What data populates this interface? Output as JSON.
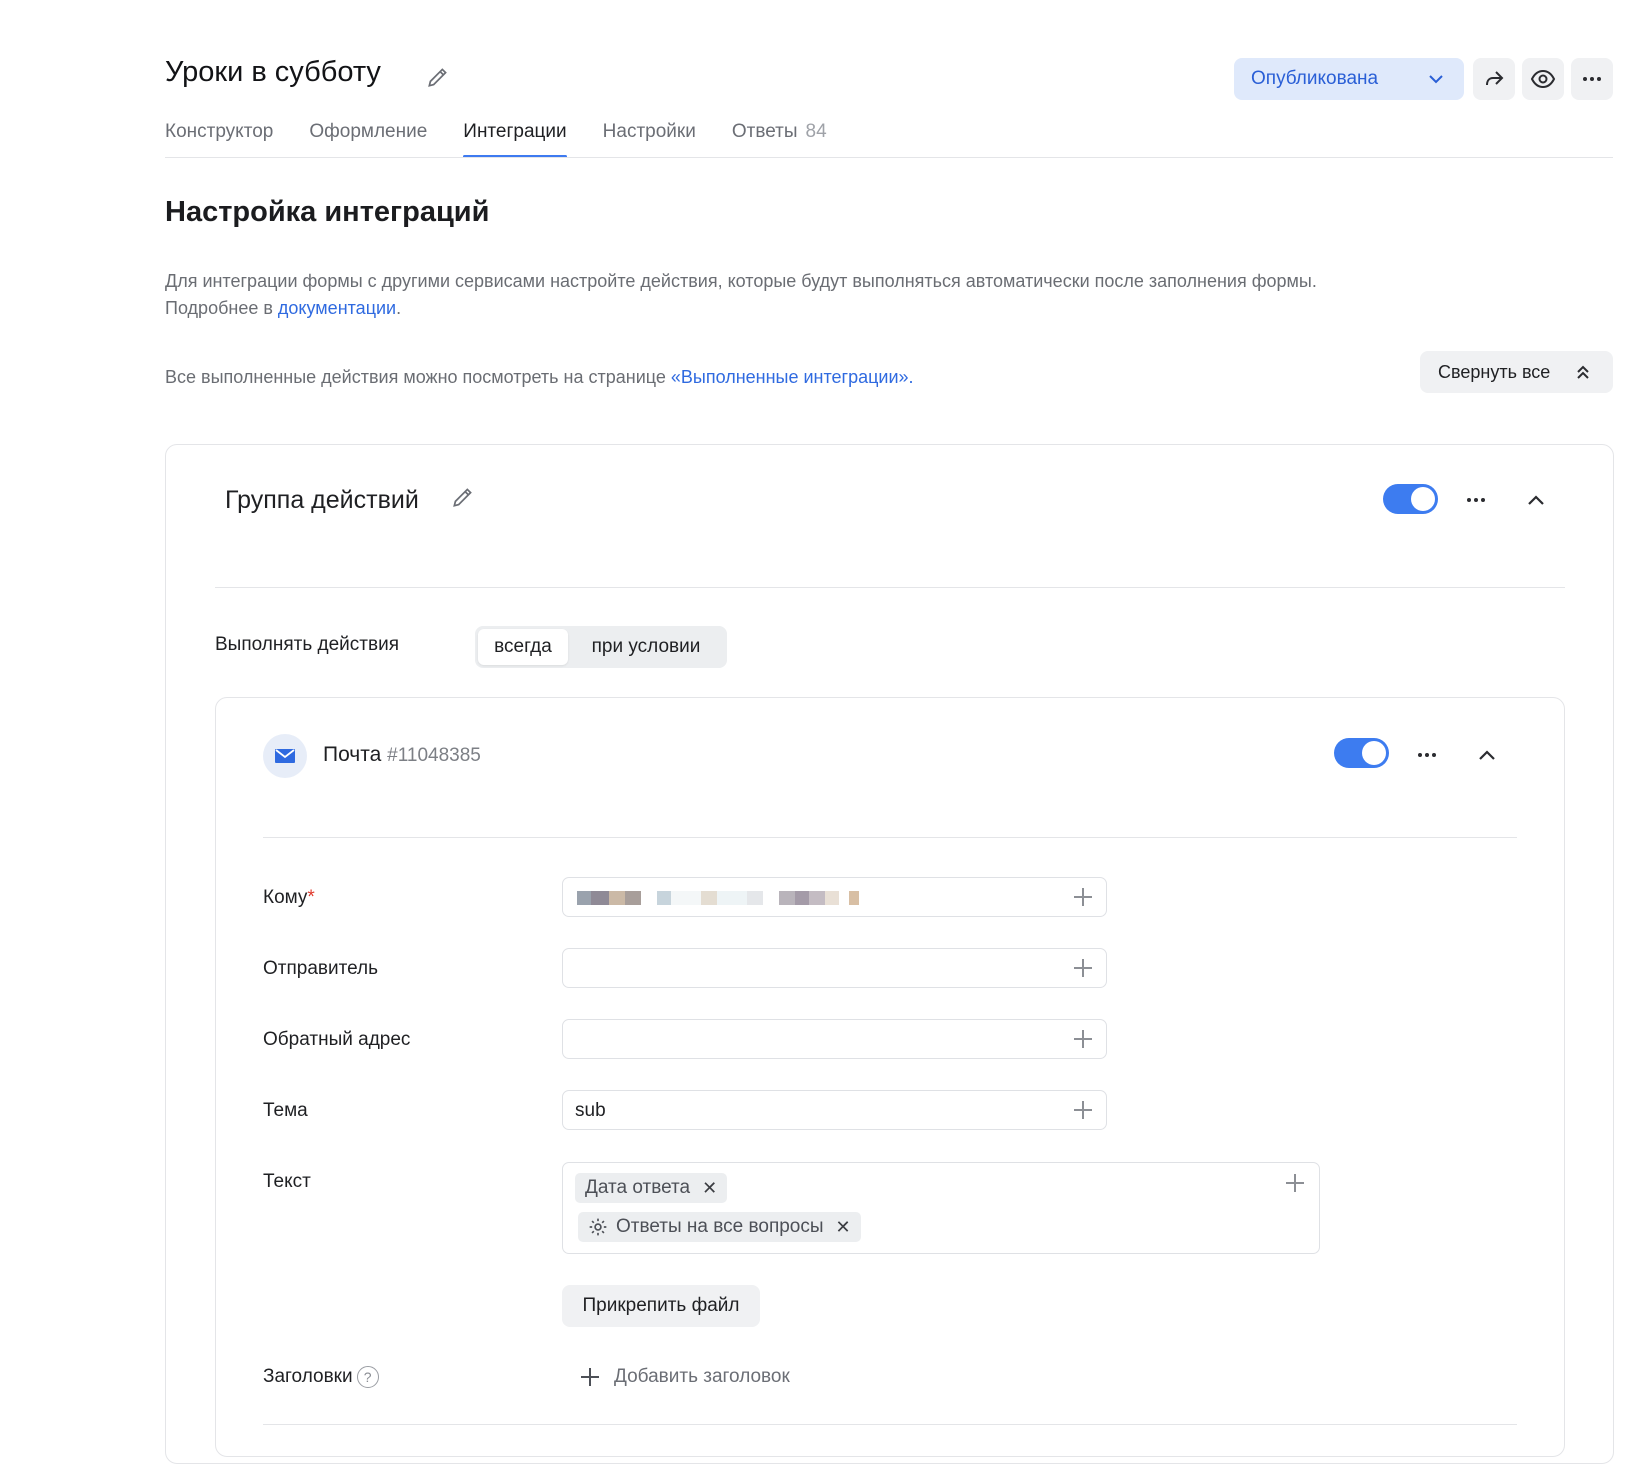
{
  "header": {
    "title": "Уроки в субботу",
    "status": "Опубликована"
  },
  "tabs": [
    {
      "label": "Конструктор"
    },
    {
      "label": "Оформление"
    },
    {
      "label": "Интеграции",
      "active": true
    },
    {
      "label": "Настройки"
    },
    {
      "label": "Ответы",
      "count": "84"
    }
  ],
  "page": {
    "heading": "Настройка интеграций",
    "desc_line1": "Для интеграции формы с другими сервисами настройте действия, которые будут выполняться автоматически после заполнения формы.",
    "desc_line2_prefix": "Подробнее в ",
    "desc_link": "документации",
    "desc_line2_suffix": ".",
    "history_prefix": "Все выполненные действия можно посмотреть на странице ",
    "history_link": "«Выполненные интеграции».",
    "collapse_all": "Свернуть все"
  },
  "group": {
    "title": "Группа действий",
    "enabled": true,
    "exec_label": "Выполнять действия",
    "exec_options": [
      "всегда",
      "при условии"
    ],
    "exec_selected": "всегда"
  },
  "mail": {
    "title": "Почта",
    "id": "#11048385",
    "enabled": true,
    "fields": {
      "to_label": "Кому",
      "sender_label": "Отправитель",
      "reply_label": "Обратный адрес",
      "subject_label": "Тема",
      "subject_value": "sub",
      "text_label": "Текст",
      "text_chips": [
        "Дата ответа",
        "Ответы на все вопросы"
      ],
      "attach_label": "Прикрепить файл",
      "headers_label": "Заголовки",
      "headers_help": "?",
      "add_header": "Добавить заголовок"
    }
  },
  "colors": {
    "accent": "#3d7cf0",
    "link": "#2f6ae0",
    "status_bg": "#dfe9fb"
  }
}
